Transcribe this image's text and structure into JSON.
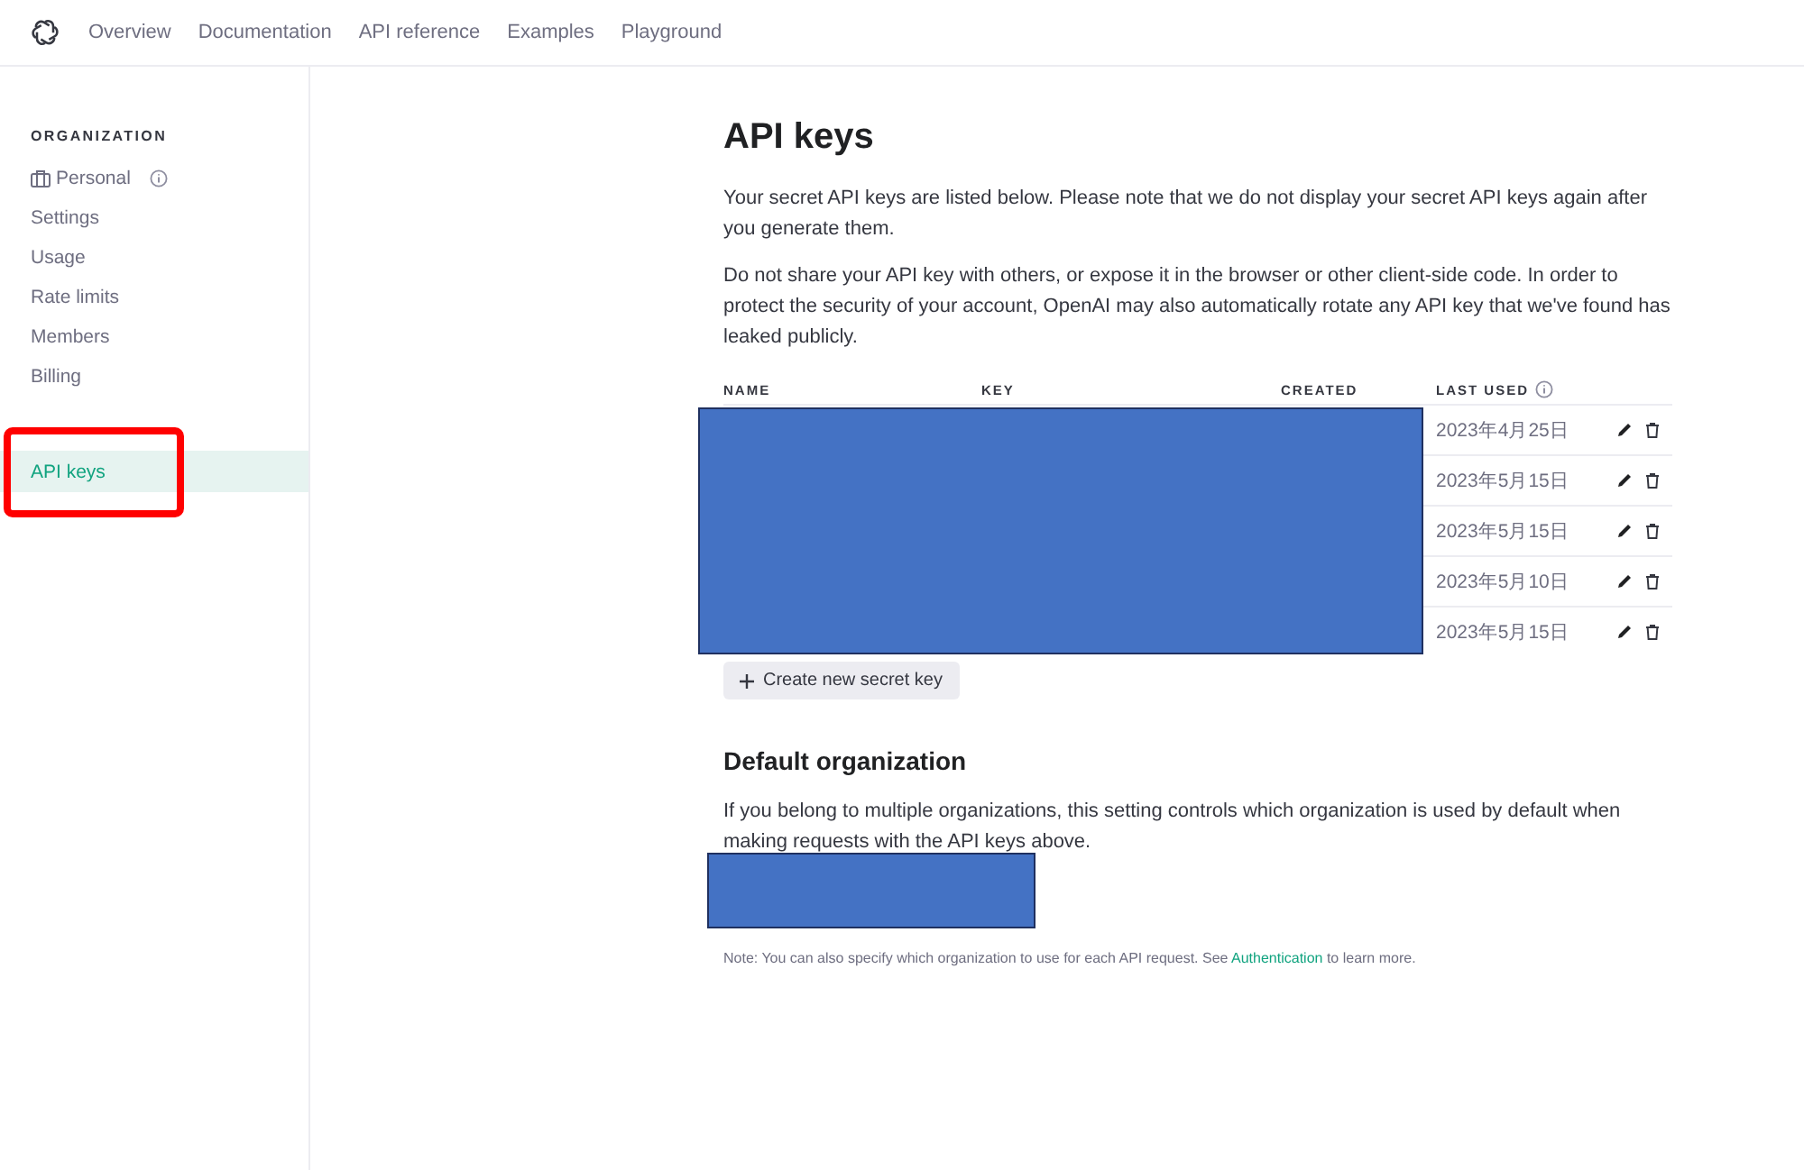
{
  "top_nav": {
    "items": [
      {
        "label": "Overview",
        "selected": false
      },
      {
        "label": "Documentation",
        "selected": false
      },
      {
        "label": "API reference",
        "selected": false
      },
      {
        "label": "Examples",
        "selected": false
      },
      {
        "label": "Playground",
        "selected": false
      }
    ]
  },
  "sidebar": {
    "section_title": "ORGANIZATION",
    "items": [
      {
        "label": "Personal",
        "kind": "org",
        "selected": false
      },
      {
        "label": "Settings",
        "kind": "link",
        "selected": false
      },
      {
        "label": "Usage",
        "kind": "link",
        "selected": false
      },
      {
        "label": "Rate limits",
        "kind": "link",
        "selected": false
      },
      {
        "label": "Members",
        "kind": "link",
        "selected": false
      },
      {
        "label": "Billing",
        "kind": "link",
        "selected": false
      },
      {
        "label": "API keys",
        "kind": "link",
        "selected": true,
        "highlighted": true
      }
    ]
  },
  "page": {
    "title": "API keys",
    "paragraphs": [
      "Your secret API keys are listed below. Please note that we do not display your secret API keys again after you generate them.",
      "Do not share your API key with others, or expose it in the browser or other client-side code. In order to protect the security of your account, OpenAI may also automatically rotate any API key that we've found has leaked publicly."
    ],
    "table": {
      "columns": [
        "NAME",
        "KEY",
        "CREATED",
        "LAST USED"
      ],
      "rows": [
        {
          "last_used": "2023年4月25日"
        },
        {
          "last_used": "2023年5月15日"
        },
        {
          "last_used": "2023年5月15日"
        },
        {
          "last_used": "2023年5月10日"
        },
        {
          "last_used": "2023年5月15日"
        }
      ]
    },
    "create_button": "Create new secret key",
    "default_org": {
      "heading": "Default organization",
      "text": "If you belong to multiple organizations, this setting controls which organization is used by default when making requests with the API keys above.",
      "note": "Note: You can also specify which organization to use for each API request. See ",
      "note_link": "Authentication",
      "note_end": " to learn more."
    }
  }
}
